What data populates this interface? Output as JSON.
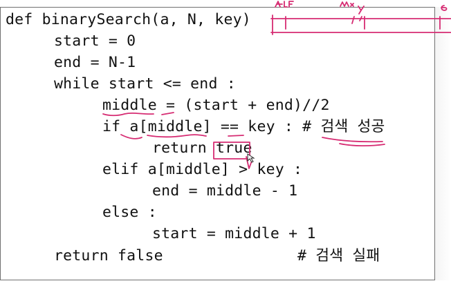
{
  "code": {
    "lines": [
      "def binarySearch(a, N, key)",
      "start = 0",
      "end = N-1",
      "while start <= end :",
      "middle = (start + end)//2",
      "if a[middle] == key : # 검색 성공",
      "return true",
      "elif a[middle] > key :",
      "end = middle - 1",
      "else :",
      "start = middle + 1",
      "return false",
      "# 검색 실패"
    ]
  },
  "annotations": {
    "ink_color": "#d62b72",
    "labels": [
      "start",
      "mid",
      "end"
    ]
  }
}
